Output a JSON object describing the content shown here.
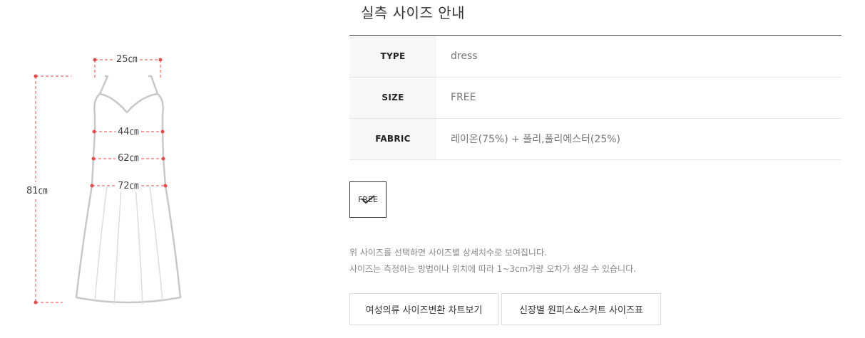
{
  "illustration": {
    "strap_width": "25㎝",
    "chest": "44㎝",
    "waist": "62㎝",
    "hip": "72㎝",
    "length": "81㎝",
    "marker_color": "#e84a4a",
    "outline_color": "#c8c8c8"
  },
  "guide": {
    "title": "실측 사이즈 안내",
    "rows": [
      {
        "label": "TYPE",
        "value": "dress"
      },
      {
        "label": "SIZE",
        "value": "FREE"
      },
      {
        "label": "FABRIC",
        "value": "레이온(75%) + 폴리,폴리에스터(25%)"
      }
    ]
  },
  "size_options": [
    {
      "label": "FREE",
      "selected": true,
      "icon": "check-icon"
    }
  ],
  "notes": {
    "line1": "위 사이즈를 선택하면 사이즈별 상세치수로 보여집니다.",
    "line2": "사이즈는 측정하는 방법이나 위치에 따라 1~3cm가량 오차가 생길 수 있습니다."
  },
  "buttons": {
    "womens_conversion": "여성의류 사이즈변환 차트보기",
    "height_chart": "신장별 원피스&스커트 사이즈표"
  }
}
